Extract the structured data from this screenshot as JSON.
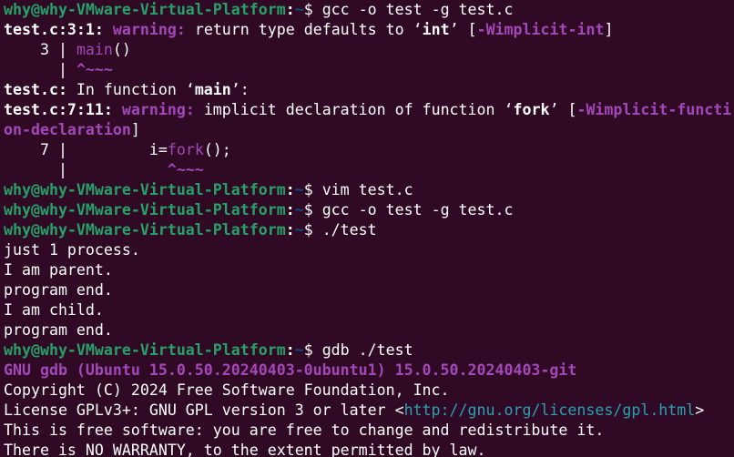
{
  "prompt": {
    "user_host": "why@why-VMware-Virtual-Platform",
    "sep": ":",
    "cwd": "~",
    "symbol": "$"
  },
  "lines": {
    "l1_cmd": " gcc -o test -g test.c",
    "l2_loc": "test.c:3:1:",
    "l2_warn": "warning:",
    "l2_text": " return type defaults to ",
    "l2_q1": "‘",
    "l2_kw": "int",
    "l2_q2": "’",
    "l2_sp": " [",
    "l2_flag": "-Wimplicit-int",
    "l2_end": "]",
    "l3_num": "    3 | ",
    "l3_code": "main",
    "l3_rest": "()",
    "l4_bar": "      | ",
    "l4_caret": "^~~~",
    "l5_file": "test.c:",
    "l5_text": " In function ",
    "l5_q1": "‘",
    "l5_kw": "main",
    "l5_q2": "’:",
    "l6_loc": "test.c:7:11:",
    "l6_warn": "warning:",
    "l6_text": " implicit declaration of function ",
    "l6_q1": "‘",
    "l6_kw": "fork",
    "l6_q2": "’",
    "l6_sp": " [",
    "l6_flag": "-Wimplicit-functi",
    "l7_flag": "on-declaration",
    "l7_end": "]",
    "l8_num": "    7 | ",
    "l8_pre": "        i=",
    "l8_fork": "fork",
    "l8_rest": "();",
    "l9_bar": "      | ",
    "l9_sp": "          ",
    "l9_caret": "^~~~",
    "l10_cmd": " vim test.c",
    "l11_cmd": " gcc -o test -g test.c",
    "l12_cmd": " ./test",
    "l13": "just 1 process.",
    "l14": "I am parent.",
    "l15": "program end.",
    "l16": "I am child.",
    "l17": "program end.",
    "l18_cmd": " gdb ./test",
    "l19": "GNU gdb (Ubuntu 15.0.50.20240403-0ubuntu1) 15.0.50.20240403-git",
    "l20": "Copyright (C) 2024 Free Software Foundation, Inc.",
    "l21_pre": "License GPLv3+: GNU GPL version 3 or later <",
    "l21_url": "http://gnu.org/licenses/gpl.html",
    "l21_end": ">",
    "l22": "This is free software: you are free to change and redistribute it.",
    "l23": "There is NO WARRANTY, to the extent permitted by law."
  },
  "colors": {
    "background": "#300a24",
    "prompt_user": "#26a269",
    "prompt_path": "#12488b",
    "warning": "#a347ba",
    "url": "#2aa1b3"
  }
}
